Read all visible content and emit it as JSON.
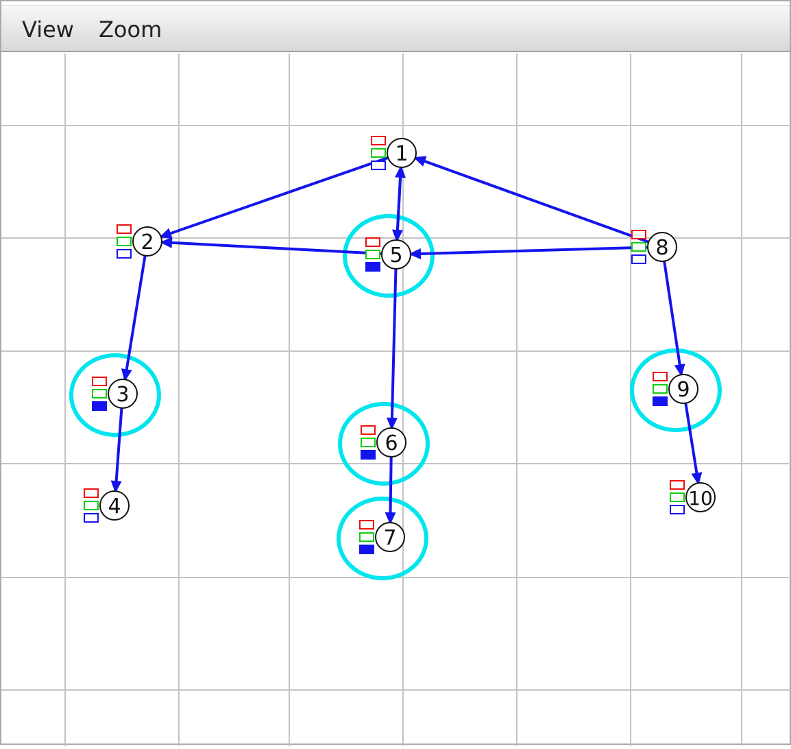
{
  "menu": {
    "view_label": "View",
    "zoom_label": "Zoom"
  },
  "colors": {
    "edge": "#1414ee",
    "highlight": "#00e5ee",
    "grid": "#c4c4c4",
    "box_red": "#ee1111",
    "box_green": "#11cc11",
    "box_blue": "#1414ee"
  },
  "graph": {
    "nodes": [
      {
        "id": "1",
        "label": "1",
        "highlighted": false,
        "blue_filled": false
      },
      {
        "id": "2",
        "label": "2",
        "highlighted": false,
        "blue_filled": false
      },
      {
        "id": "3",
        "label": "3",
        "highlighted": true,
        "blue_filled": true
      },
      {
        "id": "4",
        "label": "4",
        "highlighted": false,
        "blue_filled": false
      },
      {
        "id": "5",
        "label": "5",
        "highlighted": true,
        "blue_filled": true
      },
      {
        "id": "6",
        "label": "6",
        "highlighted": true,
        "blue_filled": true
      },
      {
        "id": "7",
        "label": "7",
        "highlighted": true,
        "blue_filled": true
      },
      {
        "id": "8",
        "label": "8",
        "highlighted": false,
        "blue_filled": false
      },
      {
        "id": "9",
        "label": "9",
        "highlighted": true,
        "blue_filled": true
      },
      {
        "id": "10",
        "label": "10",
        "highlighted": false,
        "blue_filled": false
      }
    ],
    "edges": [
      {
        "from": "1",
        "to": "2"
      },
      {
        "from": "1",
        "to": "5"
      },
      {
        "from": "5",
        "to": "1"
      },
      {
        "from": "8",
        "to": "1"
      },
      {
        "from": "5",
        "to": "2"
      },
      {
        "from": "8",
        "to": "5"
      },
      {
        "from": "2",
        "to": "3"
      },
      {
        "from": "3",
        "to": "4"
      },
      {
        "from": "5",
        "to": "6"
      },
      {
        "from": "6",
        "to": "7"
      },
      {
        "from": "8",
        "to": "9"
      },
      {
        "from": "9",
        "to": "10"
      }
    ]
  }
}
